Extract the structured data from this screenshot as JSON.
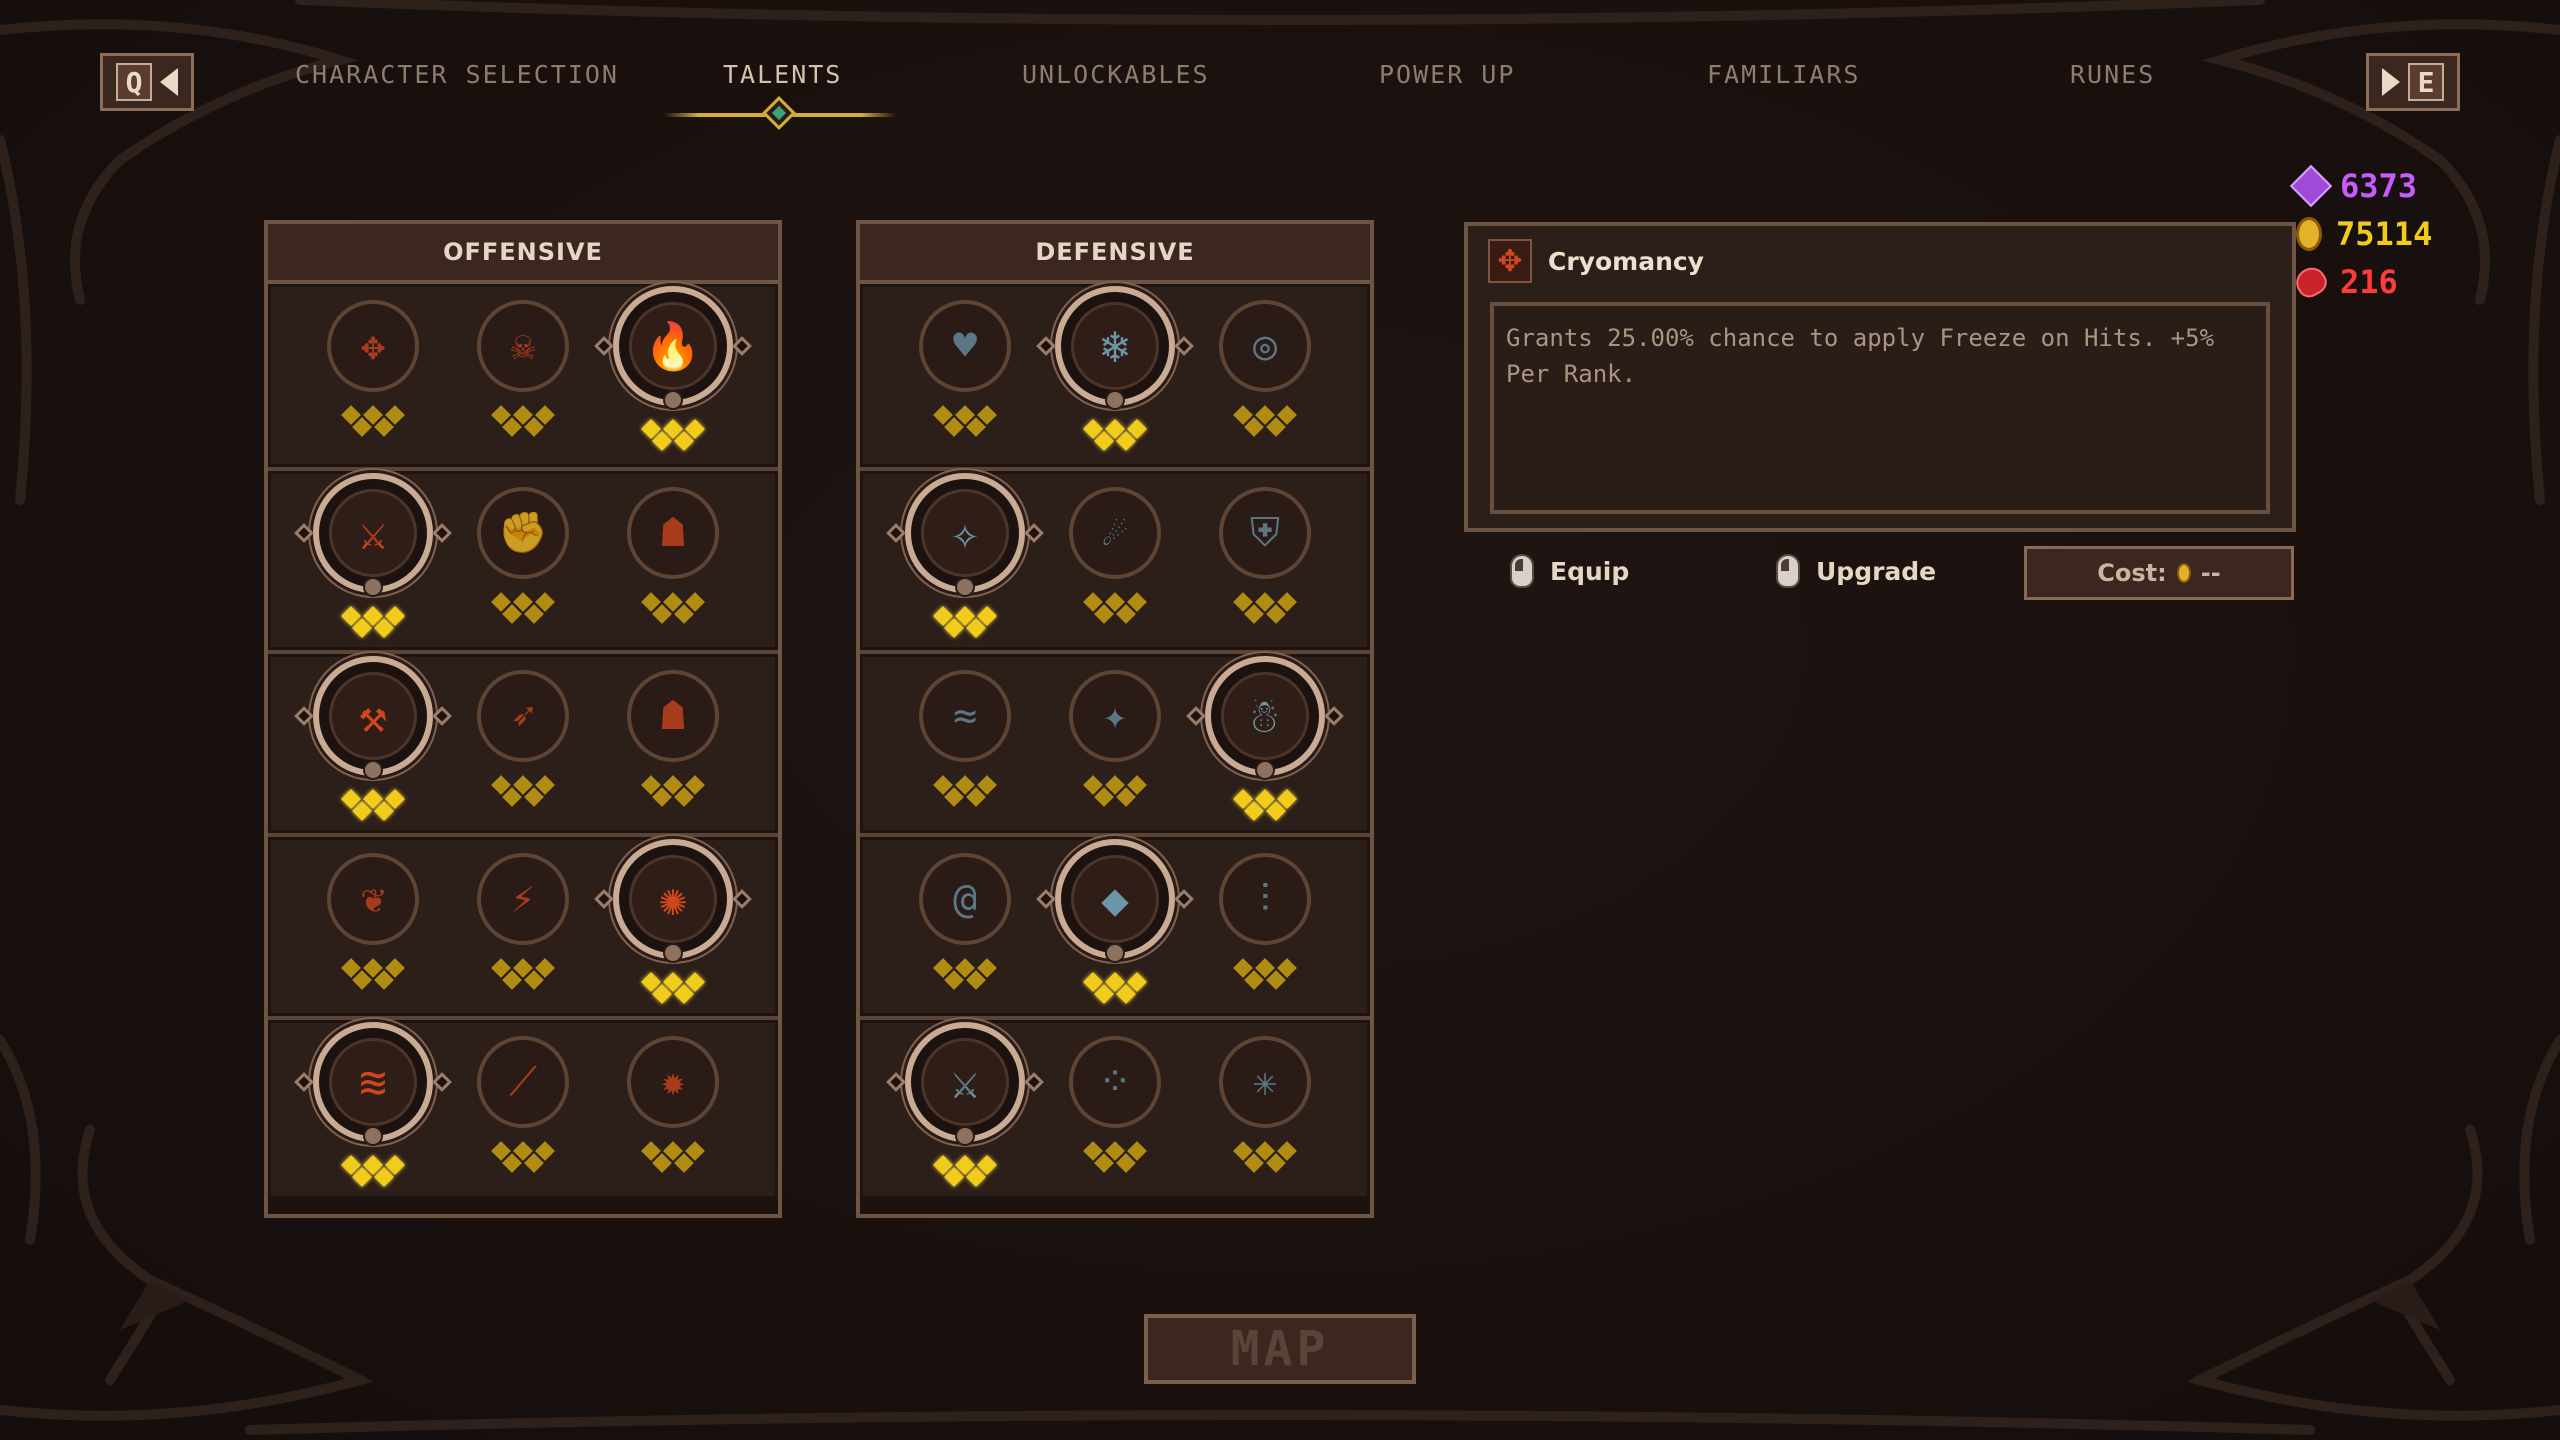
{
  "nav": {
    "prev_key": "Q",
    "next_key": "E",
    "tabs": [
      {
        "label": "CHARACTER SELECTION"
      },
      {
        "label": "TALENTS"
      },
      {
        "label": "UNLOCKABLES"
      },
      {
        "label": "POWER UP"
      },
      {
        "label": "FAMILIARS"
      },
      {
        "label": "RUNES"
      }
    ],
    "active_tab": "TALENTS"
  },
  "currency": {
    "gems": {
      "value": "6373",
      "color": "#c65cff",
      "icon": "gem-icon"
    },
    "gold": {
      "value": "75114",
      "color": "#f2cc1a",
      "icon": "coin-icon"
    },
    "blood": {
      "value": "216",
      "color": "#ff3b3b",
      "icon": "ruby-icon"
    }
  },
  "offensive": {
    "title": "OFFENSIVE",
    "rows": [
      [
        {
          "icon": "crosshair-icon",
          "glyph": "✥",
          "selected": false
        },
        {
          "icon": "demon-head-icon",
          "glyph": "☠",
          "selected": false
        },
        {
          "icon": "flame-icon",
          "glyph": "🔥",
          "selected": true
        }
      ],
      [
        {
          "icon": "claw-slash-icon",
          "glyph": "⚔",
          "selected": true
        },
        {
          "icon": "fist-icon",
          "glyph": "✊",
          "selected": false
        },
        {
          "icon": "figure-icon",
          "glyph": "☗",
          "selected": false
        }
      ],
      [
        {
          "icon": "axe-strike-icon",
          "glyph": "⚒",
          "selected": true
        },
        {
          "icon": "arrow-icon",
          "glyph": "➶",
          "selected": false
        },
        {
          "icon": "hooded-figure-icon",
          "glyph": "☗",
          "selected": false
        }
      ],
      [
        {
          "icon": "wings-icon",
          "glyph": "❦",
          "selected": false
        },
        {
          "icon": "slash-burst-icon",
          "glyph": "⚡",
          "selected": false
        },
        {
          "icon": "berserker-icon",
          "glyph": "✺",
          "selected": true
        }
      ],
      [
        {
          "icon": "multi-slash-icon",
          "glyph": "≋",
          "selected": true
        },
        {
          "icon": "blade-icon",
          "glyph": "⟋",
          "selected": false
        },
        {
          "icon": "explosion-icon",
          "glyph": "✹",
          "selected": false
        }
      ]
    ]
  },
  "defensive": {
    "title": "DEFENSIVE",
    "rows": [
      [
        {
          "icon": "heart-icon",
          "glyph": "♥",
          "selected": false
        },
        {
          "icon": "ice-swirl-icon",
          "glyph": "❄",
          "selected": true
        },
        {
          "icon": "ring-icon",
          "glyph": "◎",
          "selected": false
        }
      ],
      [
        {
          "icon": "frost-potion-icon",
          "glyph": "✧",
          "selected": true
        },
        {
          "icon": "spray-icon",
          "glyph": "☄",
          "selected": false
        },
        {
          "icon": "shield-icon",
          "glyph": "⛨",
          "selected": false
        }
      ],
      [
        {
          "icon": "wind-dash-icon",
          "glyph": "≈",
          "selected": false
        },
        {
          "icon": "sparkles-icon",
          "glyph": "✦",
          "selected": false
        },
        {
          "icon": "frost-figure-icon",
          "glyph": "☃",
          "selected": true
        }
      ],
      [
        {
          "icon": "vortex-icon",
          "glyph": "@",
          "selected": false
        },
        {
          "icon": "crystal-icon",
          "glyph": "◆",
          "selected": true
        },
        {
          "icon": "stats-icon",
          "glyph": "⫶",
          "selected": false
        }
      ],
      [
        {
          "icon": "frost-sword-icon",
          "glyph": "⚔",
          "selected": true
        },
        {
          "icon": "orbs-icon",
          "glyph": "⁘",
          "selected": false
        },
        {
          "icon": "frost-spider-icon",
          "glyph": "✳",
          "selected": false
        }
      ]
    ]
  },
  "info": {
    "name": "Cryomancy",
    "icon": "crosshair-icon",
    "description": "Grants 25.00% chance to apply Freeze on Hits. +5% Per Rank."
  },
  "actions": {
    "equip_label": "Equip",
    "upgrade_label": "Upgrade",
    "cost_label": "Cost:",
    "cost_value": "--"
  },
  "map_button": "MAP",
  "colors": {
    "gold_pip": "#f2cc1a",
    "dim_pip": "#b08d12",
    "fire": "#d2461d",
    "frost": "#6c96a8"
  }
}
